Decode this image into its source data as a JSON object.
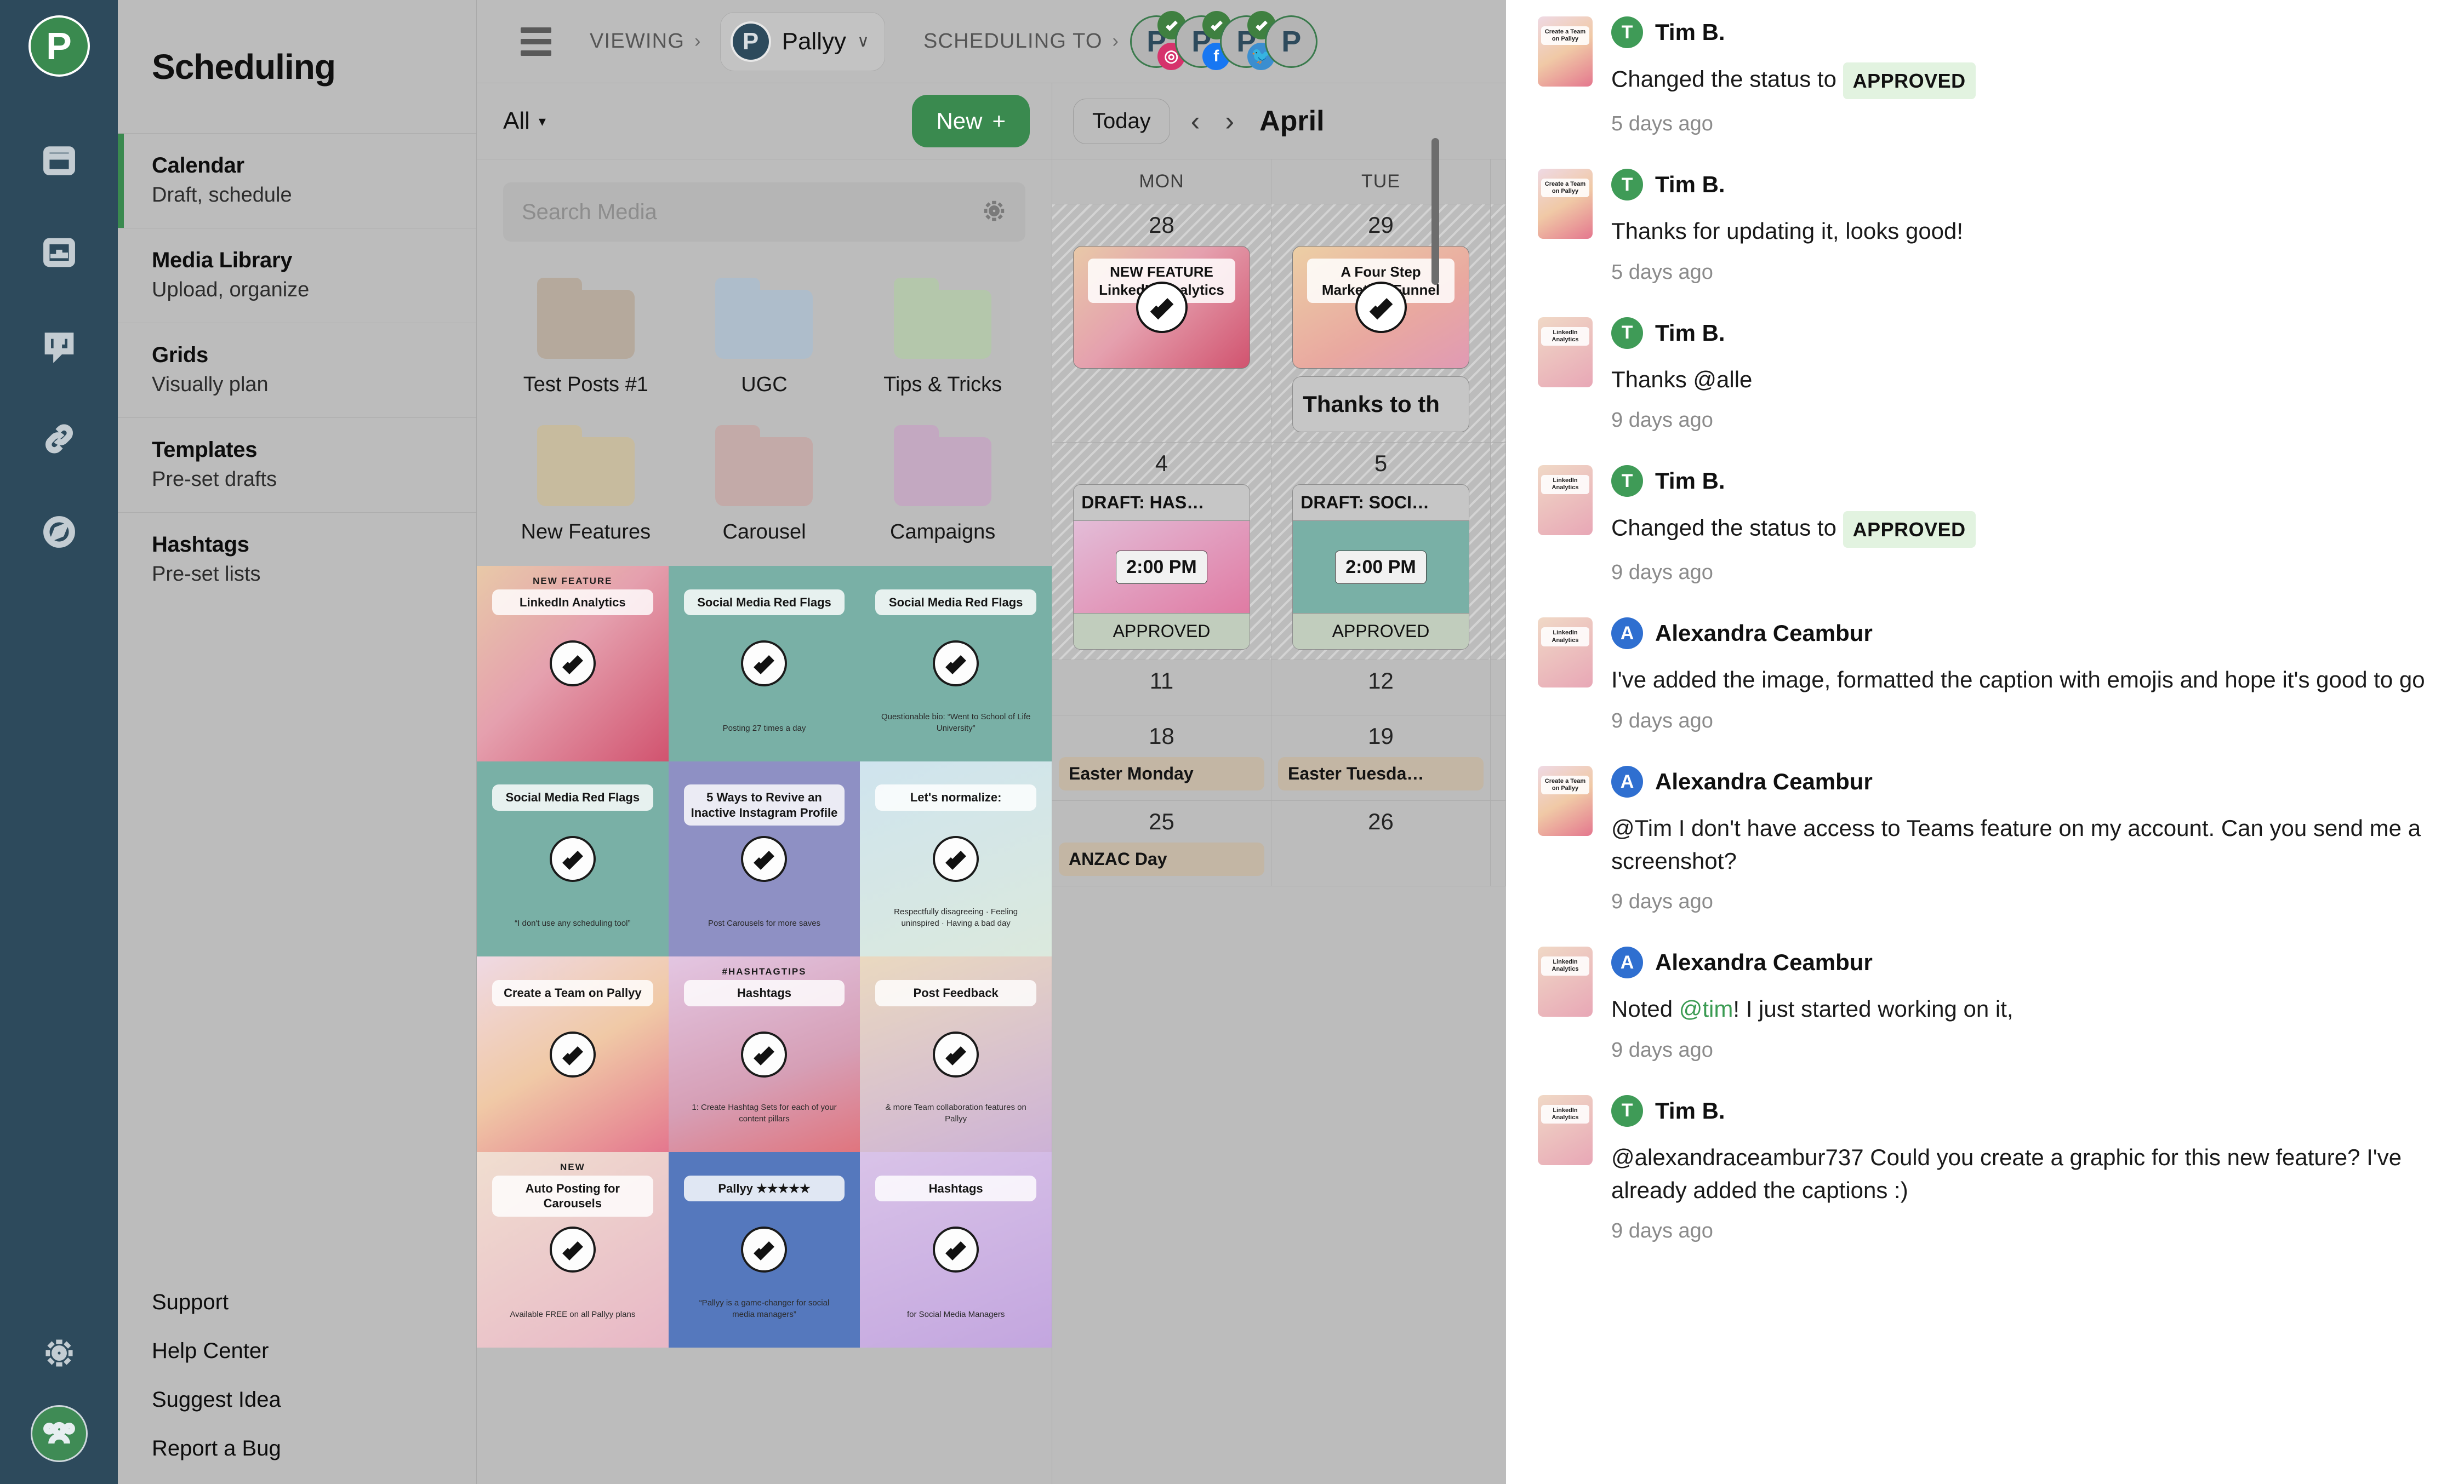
{
  "brand": {
    "logo_letter": "P"
  },
  "rail": {
    "icons": [
      {
        "name": "calendar-icon"
      },
      {
        "name": "analytics-icon"
      },
      {
        "name": "comment-icon"
      },
      {
        "name": "link-icon"
      },
      {
        "name": "compass-icon"
      }
    ],
    "settings_icon": "gear-icon",
    "team_icon": "users-icon"
  },
  "sidebar": {
    "title": "Scheduling",
    "items": [
      {
        "label": "Calendar",
        "sub": "Draft, schedule",
        "active": true
      },
      {
        "label": "Media Library",
        "sub": "Upload, organize",
        "active": false
      },
      {
        "label": "Grids",
        "sub": "Visually plan",
        "active": false
      },
      {
        "label": "Templates",
        "sub": "Pre-set drafts",
        "active": false
      },
      {
        "label": "Hashtags",
        "sub": "Pre-set lists",
        "active": false
      }
    ],
    "footer_links": [
      "Support",
      "Help Center",
      "Suggest Idea",
      "Report a Bug"
    ]
  },
  "topbar": {
    "menu_icon": "hamburger-icon",
    "viewing_label": "VIEWING",
    "viewing_chevron": "›",
    "workspace_name": "Pallyy",
    "workspace_caret": "∨",
    "scheduling_to_label": "SCHEDULING TO",
    "scheduling_to_chevron": "›",
    "accounts": [
      {
        "initial": "P",
        "network": "instagram",
        "network_color": "#d6336c",
        "connected": true
      },
      {
        "initial": "P",
        "network": "facebook",
        "network_color": "#1877f2",
        "connected": true
      },
      {
        "initial": "P",
        "network": "twitter",
        "network_color": "#3b8ed0",
        "connected": true
      },
      {
        "initial": "P",
        "network": "",
        "network_color": "",
        "connected": false
      }
    ]
  },
  "media": {
    "filter_label": "All",
    "filter_caret": "▾",
    "new_button": "New",
    "new_plus": "+",
    "search_placeholder": "Search Media",
    "search_value": "",
    "settings_icon": "gear-icon",
    "folders": [
      {
        "name": "Test Posts #1",
        "color": "#b5a99c"
      },
      {
        "name": "UGC",
        "color": "#aebdcb"
      },
      {
        "name": "Tips & Tricks",
        "color": "#b4c7ab"
      },
      {
        "name": "New Features",
        "color": "#c7bb9e"
      },
      {
        "name": "Carousel",
        "color": "#c3aaa8"
      },
      {
        "name": "Campaigns",
        "color": "#c3a8c1"
      }
    ],
    "thumbnails": [
      {
        "eyebrow": "NEW FEATURE",
        "caption": "LinkedIn Analytics",
        "sub": "",
        "bg": "linear-gradient(135deg,#e8c9a8 0%,#e5a0ae 45%,#d1536f 100%)",
        "checked": true
      },
      {
        "eyebrow": "",
        "caption": "Social Media Red Flags",
        "sub": "Posting 27 times a day",
        "bg": "#79b0a6",
        "checked": true
      },
      {
        "eyebrow": "",
        "caption": "Social Media Red Flags",
        "sub": "Questionable bio: “Went to School of Life University”",
        "bg": "#79b0a6",
        "checked": true
      },
      {
        "eyebrow": "",
        "caption": "Social Media Red Flags",
        "sub": "“I don't use any scheduling tool”",
        "bg": "#79b0a6",
        "checked": true
      },
      {
        "eyebrow": "",
        "caption": "5 Ways to Revive an Inactive Instagram Profile",
        "sub": "Post Carousels for more saves",
        "bg": "#8e90c4",
        "checked": true
      },
      {
        "eyebrow": "",
        "caption": "Let's normalize:",
        "sub": "Respectfully disagreeing · Feeling uninspired · Having a bad day",
        "bg": "linear-gradient(160deg,#cfe4ee 0%,#dbe9dd 100%)",
        "checked": true
      },
      {
        "eyebrow": "",
        "caption": "Create a Team on Pallyy",
        "sub": "",
        "bg": "linear-gradient(150deg,#efd9e4 0%,#f0c9a6 50%,#e4778e 100%)",
        "checked": true
      },
      {
        "eyebrow": "#HASHTAGTIPS",
        "caption": "Hashtags",
        "sub": "1: Create Hashtag Sets for each of your content pillars",
        "bg": "linear-gradient(160deg,#e3c6e2 0%,#d69fb6 60%,#e0757e 100%)",
        "checked": true
      },
      {
        "eyebrow": "",
        "caption": "Post Feedback",
        "sub": "& more Team collaboration features on Pallyy",
        "bg": "linear-gradient(160deg,#ead9c0 0%,#cdb2d6 100%)",
        "checked": true
      },
      {
        "eyebrow": "NEW",
        "caption": "Auto Posting for Carousels",
        "sub": "Available FREE on all Pallyy plans",
        "bg": "linear-gradient(150deg,#f0ded0 0%,#e8b7c6 100%)",
        "checked": true
      },
      {
        "eyebrow": "",
        "caption": "Pallyy ★★★★★",
        "sub": "“Pallyy is a game-changer for social media managers”",
        "bg": "#5578bd",
        "checked": true
      },
      {
        "eyebrow": "",
        "caption": "Hashtags",
        "sub": "for Social Media Managers",
        "bg": "linear-gradient(160deg,#d9c3e8 0%,#c3a6df 100%)",
        "checked": true
      }
    ]
  },
  "calendar": {
    "today_button": "Today",
    "prev_icon": "‹",
    "next_icon": "›",
    "month": "April",
    "day_headers": [
      "MON",
      "TUE"
    ],
    "weeks": [
      {
        "days": [
          {
            "num": "28",
            "out_of_month": true,
            "card": {
              "type": "image",
              "eyebrow": "NEW FEATURE",
              "title": "LinkedIn Analytics",
              "bg": "linear-gradient(135deg,#e8c9a8 0%,#e5a0ae 45%,#d1536f 100%)",
              "checked": true
            }
          },
          {
            "num": "29",
            "out_of_month": true,
            "card": {
              "type": "image",
              "eyebrow": "",
              "title": "A Four Step Marketing Funnel",
              "bg": "linear-gradient(150deg,#eccfa5 0%,#e9a8a0 60%,#e09ab4 100%)",
              "checked": true
            },
            "extra_card": "Thanks to th"
          }
        ]
      },
      {
        "days": [
          {
            "num": "4",
            "out_of_month": true,
            "post": {
              "title": "DRAFT: HAS…",
              "time": "2:00 PM",
              "status": "APPROVED",
              "bg": "linear-gradient(150deg,#e3bdd8 0%,#e07ba3 100%)"
            }
          },
          {
            "num": "5",
            "out_of_month": true,
            "post": {
              "title": "DRAFT: SOCI…",
              "time": "2:00 PM",
              "status": "APPROVED",
              "bg": "#79b0a6"
            }
          }
        ]
      },
      {
        "days": [
          {
            "num": "11",
            "out_of_month": false
          },
          {
            "num": "12",
            "out_of_month": false
          }
        ]
      },
      {
        "days": [
          {
            "num": "18",
            "out_of_month": false,
            "holiday": "Easter Monday"
          },
          {
            "num": "19",
            "out_of_month": false,
            "holiday": "Easter Tuesda…"
          }
        ]
      },
      {
        "days": [
          {
            "num": "25",
            "out_of_month": false,
            "holiday": "ANZAC Day"
          },
          {
            "num": "26",
            "out_of_month": false
          }
        ]
      }
    ]
  },
  "activity": {
    "items": [
      {
        "author": "Tim B.",
        "initial": "T",
        "avatar_color": "#3f9b57",
        "message_prefix": "Changed the status to",
        "badge": "APPROVED",
        "message_suffix": "",
        "time": "5 days ago",
        "thumb_caption": "Create a Team on Pallyy",
        "thumb_bg": "linear-gradient(150deg,#efd9e4 0%,#f0c9a6 50%,#e4778e 100%)"
      },
      {
        "author": "Tim B.",
        "initial": "T",
        "avatar_color": "#3f9b57",
        "message_prefix": "Thanks for updating it, looks good!",
        "badge": "",
        "message_suffix": "",
        "time": "5 days ago",
        "thumb_caption": "Create a Team on Pallyy",
        "thumb_bg": "linear-gradient(150deg,#efd9e4 0%,#f0c9a6 50%,#e4778e 100%)"
      },
      {
        "author": "Tim B.",
        "initial": "T",
        "avatar_color": "#3f9b57",
        "message_prefix": "Thanks @alle",
        "badge": "",
        "message_suffix": "",
        "time": "9 days ago",
        "thumb_caption": "LinkedIn Analytics",
        "thumb_bg": "linear-gradient(150deg,#f0d9c6 0%,#e8a7b6 100%)"
      },
      {
        "author": "Tim B.",
        "initial": "T",
        "avatar_color": "#3f9b57",
        "message_prefix": "Changed the status to",
        "badge": "APPROVED",
        "message_suffix": "",
        "time": "9 days ago",
        "thumb_caption": "LinkedIn Analytics",
        "thumb_bg": "linear-gradient(150deg,#f0d9c6 0%,#e8a7b6 100%)"
      },
      {
        "author": "Alexandra Ceambur",
        "initial": "A",
        "avatar_color": "#2f6fd0",
        "message_prefix": "I've added the image, formatted the caption with emojis and hope it's good to go",
        "badge": "",
        "message_suffix": "",
        "time": "9 days ago",
        "thumb_caption": "LinkedIn Analytics",
        "thumb_bg": "linear-gradient(150deg,#f0d9c6 0%,#e8a7b6 100%)"
      },
      {
        "author": "Alexandra Ceambur",
        "initial": "A",
        "avatar_color": "#2f6fd0",
        "message_prefix": "@Tim I don't have access to Teams feature on my account. Can you send me a screenshot?",
        "badge": "",
        "message_suffix": "",
        "time": "9 days ago",
        "thumb_caption": "Create a Team on Pallyy",
        "thumb_bg": "linear-gradient(150deg,#efd9e4 0%,#f0c9a6 50%,#e4778e 100%)"
      },
      {
        "author": "Alexandra Ceambur",
        "initial": "A",
        "avatar_color": "#2f6fd0",
        "message_prefix": "Noted ",
        "mention": "@tim",
        "message_suffix": "! I just started working on it,",
        "badge": "",
        "time": "9 days ago",
        "thumb_caption": "LinkedIn Analytics",
        "thumb_bg": "linear-gradient(150deg,#f0d9c6 0%,#e8a7b6 100%)"
      },
      {
        "author": "Tim B.",
        "initial": "T",
        "avatar_color": "#3f9b57",
        "message_prefix": "@alexandraceambur737 Could you create a graphic for this new feature? I've already added the captions :)",
        "badge": "",
        "message_suffix": "",
        "time": "9 days ago",
        "thumb_caption": "LinkedIn Analytics",
        "thumb_bg": "linear-gradient(150deg,#f0d9c6 0%,#e8a7b6 100%)"
      }
    ]
  }
}
